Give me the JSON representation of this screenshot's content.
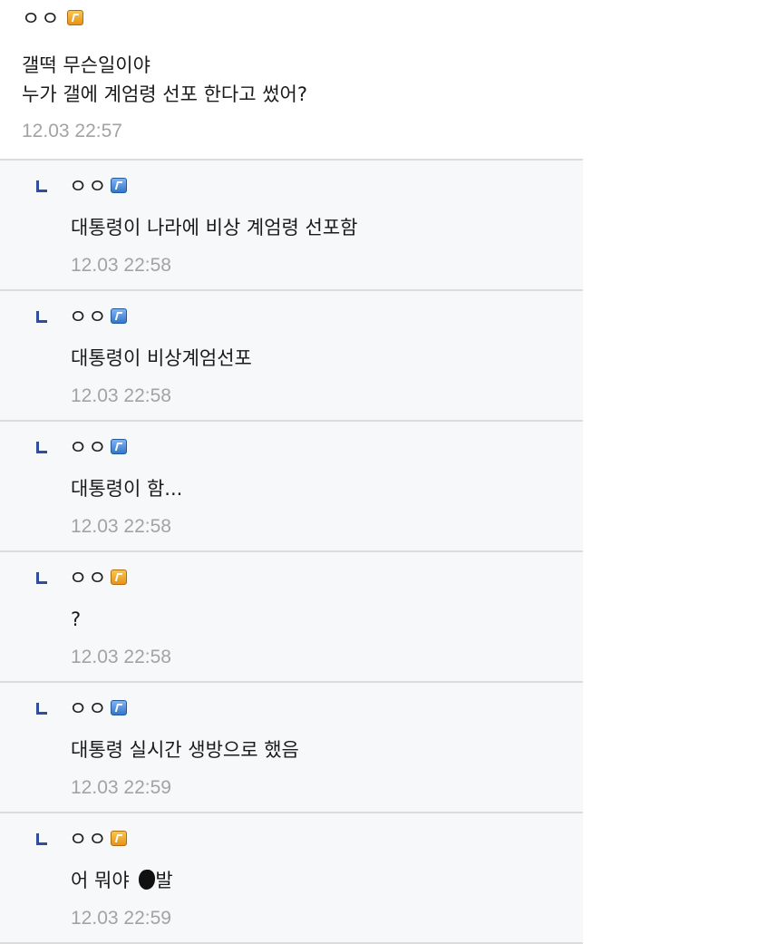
{
  "main_comment": {
    "author": "ㅇㅇ",
    "badge": "orange",
    "lines": [
      "갤떡 무슨일이야",
      "누가 갤에 계엄령 선포 한다고 썼어?"
    ],
    "time": "12.03 22:57"
  },
  "replies": [
    {
      "author": "ㅇㅇ",
      "badge": "blue",
      "text": "대통령이 나라에 비상 계엄령 선포함",
      "time": "12.03 22:58"
    },
    {
      "author": "ㅇㅇ",
      "badge": "blue",
      "text": "대통령이 비상계엄선포",
      "time": "12.03 22:58"
    },
    {
      "author": "ㅇㅇ",
      "badge": "blue",
      "text": "대통령이 함...",
      "time": "12.03 22:58"
    },
    {
      "author": "ㅇㅇ",
      "badge": "orange",
      "text": "?",
      "time": "12.03 22:58"
    },
    {
      "author": "ㅇㅇ",
      "badge": "blue",
      "text": "대통령 실시간 생방으로 했음",
      "time": "12.03 22:59"
    },
    {
      "author": "ㅇㅇ",
      "badge": "orange",
      "text_before": "어 뭐야",
      "text_after": "발",
      "censored": true,
      "time": "12.03 22:59"
    }
  ],
  "icons": {
    "reply": "reply-corner-icon",
    "badge": "gallery-member-badge-icon"
  },
  "colors": {
    "reply_background": "#f7f8fa",
    "divider": "#dcdcdc",
    "timestamp": "#a3a3a3",
    "reply_icon": "#2f4f9e",
    "badge_orange": "#e6931c",
    "badge_blue": "#3576c9"
  }
}
